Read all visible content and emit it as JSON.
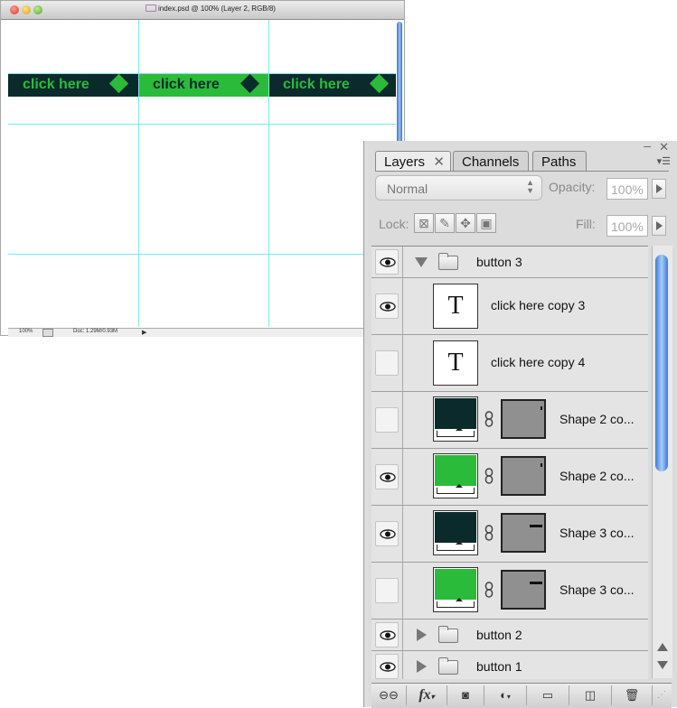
{
  "document": {
    "title": "index.psd @ 100% (Layer 2, RGB/8)",
    "buttons": [
      {
        "label": "click here",
        "diamond_color": "#2bbb3a"
      },
      {
        "label": "click here",
        "diamond_color": "#0b2a2c"
      },
      {
        "label": "click here",
        "diamond_color": "#2bbb3a"
      }
    ],
    "button_bg_colors": [
      "#0b2a2c",
      "#2bbb3a",
      "#0b2a2c"
    ],
    "status": {
      "zoom": "100%",
      "doc_size": "Doc: 1.29M/0.93M"
    }
  },
  "panel": {
    "tabs": [
      {
        "label": "Layers"
      },
      {
        "label": "Channels"
      },
      {
        "label": "Paths"
      }
    ],
    "blend_mode": "Normal",
    "opacity_label": "Opacity:",
    "opacity_value": "100%",
    "lock_label": "Lock:",
    "fill_label": "Fill:",
    "fill_value": "100%",
    "layers": [
      {
        "name": "button 3",
        "type": "group",
        "expanded": true,
        "visible": true
      },
      {
        "name": "click here copy 3",
        "type": "text",
        "visible": true
      },
      {
        "name": "click here copy 4",
        "type": "text",
        "visible": false
      },
      {
        "name": "Shape 2 co...",
        "type": "shape",
        "color": "#0b2a2c",
        "visible": false
      },
      {
        "name": "Shape 2 co...",
        "type": "shape",
        "color": "#2bbb3a",
        "visible": true
      },
      {
        "name": "Shape 3 co...",
        "type": "shape",
        "color": "#0b2a2c",
        "visible": true
      },
      {
        "name": "Shape 3 co...",
        "type": "shape",
        "color": "#2bbb3a",
        "visible": false
      },
      {
        "name": "button 2",
        "type": "group",
        "expanded": false,
        "visible": true
      },
      {
        "name": "button 1",
        "type": "group",
        "expanded": false,
        "visible": true
      }
    ],
    "text_thumb_glyph": "T",
    "bottom_buttons": [
      "link-layers",
      "fx",
      "add-mask",
      "adjustment",
      "new-group",
      "new-layer",
      "delete"
    ],
    "fx_label": "fx"
  }
}
